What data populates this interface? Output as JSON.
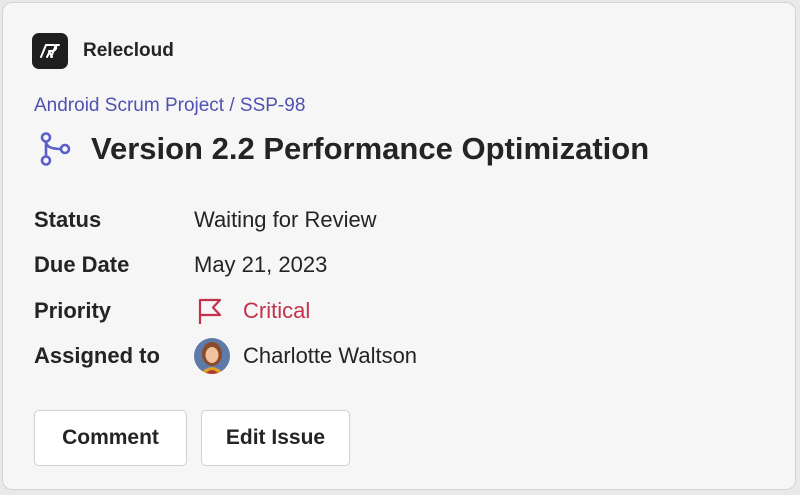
{
  "app": {
    "name": "Relecloud",
    "logo_icon": "relecloud-logo-icon"
  },
  "breadcrumb": "Android Scrum Project / SSP-98",
  "issue": {
    "icon": "branch-icon",
    "title": "Version 2.2 Performance Optimization"
  },
  "facts": [
    {
      "label": "Status",
      "value": "Waiting for Review"
    },
    {
      "label": "Due Date",
      "value": "May 21, 2023"
    },
    {
      "label": "Priority",
      "value": "Critical",
      "icon": "flag-icon",
      "color": "#c4314b"
    },
    {
      "label": "Assigned to",
      "value": "Charlotte Waltson",
      "icon": "avatar"
    }
  ],
  "actions": {
    "comment_label": "Comment",
    "edit_label": "Edit Issue"
  },
  "colors": {
    "link": "#4f52b2",
    "critical": "#c4314b",
    "card_bg": "#f6f6f6"
  }
}
